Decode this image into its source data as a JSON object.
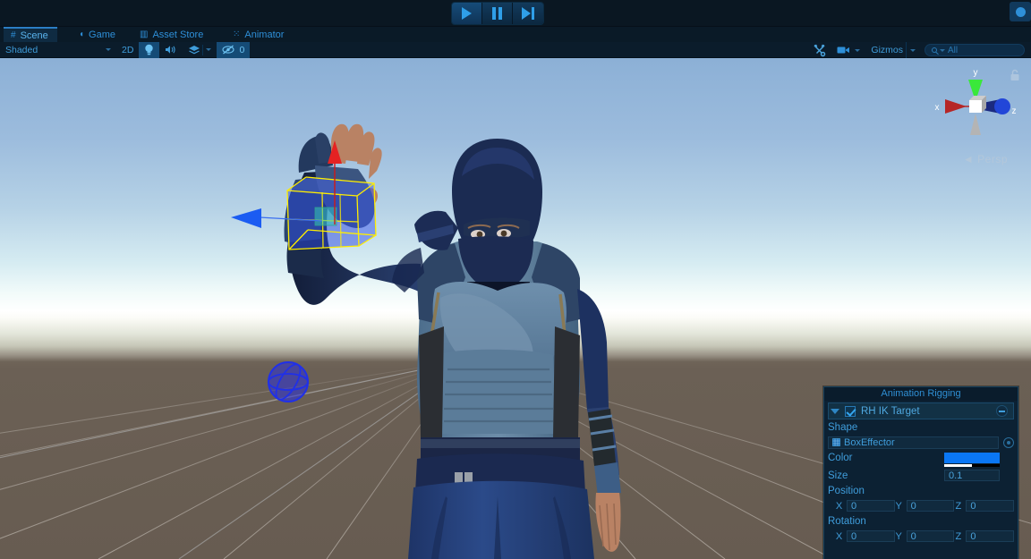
{
  "topbar": {
    "play_label": "Play",
    "pause_label": "Pause",
    "step_label": "Step",
    "play_icon": "play-triangle-icon",
    "pause_icon": "pause-bars-icon",
    "step_icon": "step-forward-icon",
    "cloud_icon": "collab-cloud-icon"
  },
  "tabs": [
    {
      "label": "Scene",
      "icon": "grid-hash-icon",
      "active": true
    },
    {
      "label": "Game",
      "icon": "gamepad-icon",
      "active": false
    },
    {
      "label": "Asset Store",
      "icon": "store-bag-icon",
      "active": false
    },
    {
      "label": "Animator",
      "icon": "animator-node-icon",
      "active": false
    }
  ],
  "panel_menu_icon": "panel-options-hamburger-icon",
  "scene_toolbar": {
    "draw_mode": "Shaded",
    "view_mode_2d": "2D",
    "lighting_icon": "lightbulb-icon",
    "lighting_on": true,
    "audio_icon": "speaker-icon",
    "fx_icon": "effects-layers-icon",
    "hidden_icon": "eye-slash-icon",
    "hidden_count": "0",
    "tools_icon": "tools-wrench-screwdriver-icon",
    "camera_icon": "camera-icon",
    "gizmos_label": "Gizmos",
    "search_icon": "magnifier-icon",
    "search_value": "All",
    "search_placeholder": "All"
  },
  "orientation_gizmo": {
    "axis_x": "x",
    "axis_y": "y",
    "axis_z": "z",
    "projection": "Persp",
    "persp_arrow": "◄",
    "lock_icon": "padlock-icon",
    "color_x": "#b62626",
    "color_y": "#2fd42f",
    "color_z": "#2246d8"
  },
  "scene_objects": {
    "selected_effector": "BoxEffector",
    "selected_outline_color": "#ffee00",
    "effector_fill_color": "#2a45e0",
    "move_gizmo_y_color": "#e01010",
    "move_gizmo_x_color": "#1a5cf0",
    "sphere_effector_color": "#2a30d8",
    "character_name": "Ninja"
  },
  "rig_panel": {
    "title": "Animation Rigging",
    "target_name": "RH IK Target",
    "target_enabled": true,
    "foldout_icon": "foldout-triangle-down-icon",
    "remove_icon": "minus-circle-icon",
    "shape_label": "Shape",
    "shape_value": "BoxEffector",
    "shape_type_icon": "mesh-grid-icon",
    "picker_icon": "object-picker-target-icon",
    "color_label": "Color",
    "color_value": "#0a77f5",
    "color_alpha": "50",
    "size_label": "Size",
    "size_value": "0.1",
    "position_label": "Position",
    "position": {
      "x_axis": "X",
      "x": "0",
      "y_axis": "Y",
      "y": "0",
      "z_axis": "Z",
      "z": "0"
    },
    "rotation_label": "Rotation",
    "rotation": {
      "x_axis": "X",
      "x": "0",
      "y_axis": "Y",
      "y": "0",
      "z_axis": "Z",
      "z": "0"
    }
  }
}
